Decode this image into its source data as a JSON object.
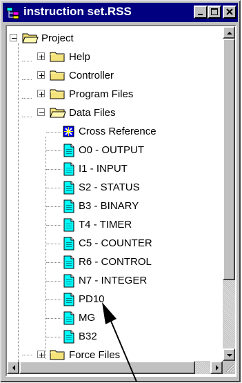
{
  "window": {
    "title": "instruction set.RSS",
    "icons": {
      "app": "project-tree-icon",
      "minimize": "minimize-icon",
      "maximize": "maximize-icon",
      "close": "close-icon"
    }
  },
  "tree": {
    "root": {
      "label": "Project",
      "icon": "folder-open-icon",
      "expanded": true
    },
    "folders": [
      {
        "label": "Help",
        "icon": "folder-icon",
        "expanded": false
      },
      {
        "label": "Controller",
        "icon": "folder-icon",
        "expanded": false
      },
      {
        "label": "Program Files",
        "icon": "folder-icon",
        "expanded": false
      },
      {
        "label": "Data Files",
        "icon": "folder-open-icon",
        "expanded": true
      }
    ],
    "data_files": [
      {
        "label": "Cross Reference",
        "icon": "cross-reference-icon"
      },
      {
        "label": "O0 - OUTPUT",
        "icon": "data-file-icon"
      },
      {
        "label": "I1 - INPUT",
        "icon": "data-file-icon"
      },
      {
        "label": "S2 - STATUS",
        "icon": "data-file-icon"
      },
      {
        "label": "B3 - BINARY",
        "icon": "data-file-icon"
      },
      {
        "label": "T4 - TIMER",
        "icon": "data-file-icon"
      },
      {
        "label": "C5 - COUNTER",
        "icon": "data-file-icon"
      },
      {
        "label": "R6 - CONTROL",
        "icon": "data-file-icon"
      },
      {
        "label": "N7 - INTEGER",
        "icon": "data-file-icon"
      },
      {
        "label": "PD10",
        "icon": "data-file-icon"
      },
      {
        "label": "MG",
        "icon": "data-file-icon"
      },
      {
        "label": "B32",
        "icon": "data-file-icon"
      }
    ],
    "after": [
      {
        "label": "Force Files",
        "icon": "folder-icon",
        "expanded": false
      }
    ]
  },
  "colors": {
    "title_bar": "#000080",
    "folder": "#f4e27a",
    "data_file": "#00ffff"
  }
}
